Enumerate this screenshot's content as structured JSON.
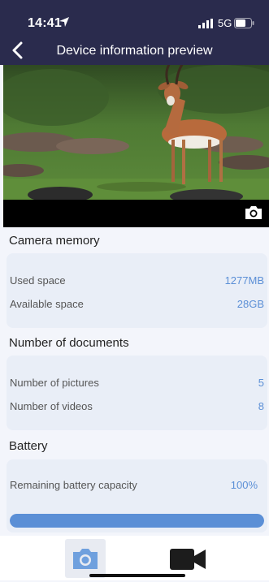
{
  "status_bar": {
    "time": "14:41",
    "network": "5G"
  },
  "nav": {
    "title": "Device information preview"
  },
  "camera_memory": {
    "title": "Camera memory",
    "used_label": "Used space",
    "used_value": "1277MB",
    "available_label": "Available space",
    "available_value": "28GB"
  },
  "documents": {
    "title": "Number of documents",
    "pictures_label": "Number of pictures",
    "pictures_value": "5",
    "videos_label": "Number of videos",
    "videos_value": "8"
  },
  "battery": {
    "title": "Battery",
    "remaining_label": "Remaining battery capacity",
    "remaining_value": "100%",
    "level_percent": 100
  },
  "colors": {
    "header": "#2a2b4d",
    "accent": "#5b8fd6",
    "card": "#e9eef7"
  },
  "icons": [
    "location-arrow-icon",
    "signal-icon",
    "battery-icon",
    "back-icon",
    "camera-icon",
    "video-camera-icon"
  ]
}
